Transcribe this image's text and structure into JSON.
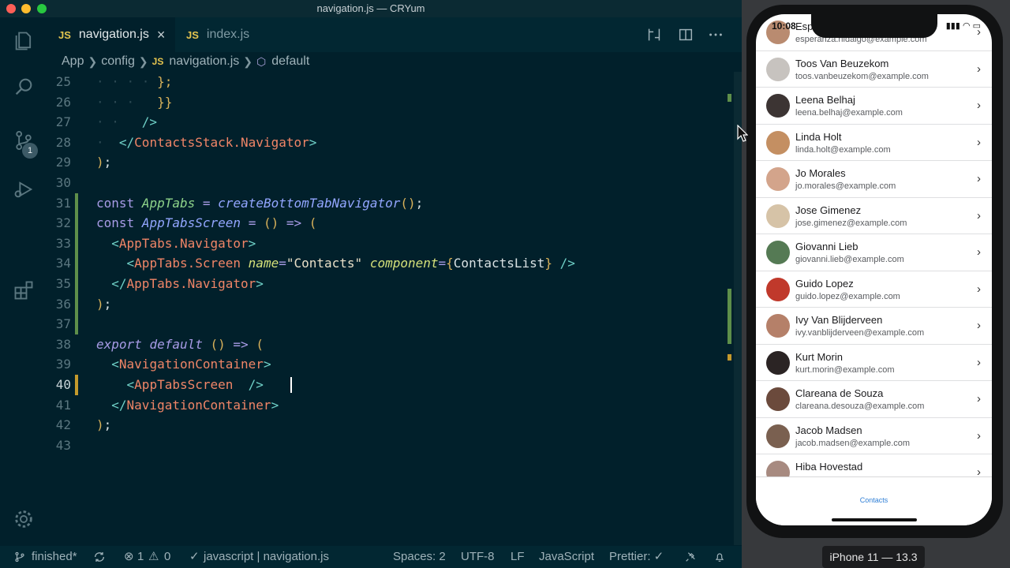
{
  "window": {
    "title": "navigation.js — CRYum"
  },
  "tabs": [
    {
      "label": "navigation.js",
      "badge": "JS",
      "active": true
    },
    {
      "label": "index.js",
      "badge": "JS",
      "active": false
    }
  ],
  "activity": {
    "scm_badge": "1"
  },
  "breadcrumb": {
    "items": [
      "App",
      "config",
      "navigation.js",
      "default"
    ],
    "file_badge": "JS"
  },
  "editor": {
    "line_numbers": [
      "25",
      "26",
      "27",
      "28",
      "29",
      "30",
      "31",
      "32",
      "33",
      "34",
      "35",
      "36",
      "37",
      "38",
      "39",
      "40",
      "41",
      "42",
      "43"
    ],
    "current_line": "40"
  },
  "statusbar": {
    "branch": "finished*",
    "errors": "1",
    "warnings": "0",
    "lang_check": "javascript | navigation.js",
    "spaces": "Spaces: 2",
    "encoding": "UTF-8",
    "eol": "LF",
    "language": "JavaScript",
    "prettier": "Prettier: ✓"
  },
  "simulator": {
    "time": "10:08",
    "contacts": [
      {
        "name": "Esperanza Hidalgo",
        "email": "esperanza.hidalgo@example.com",
        "color": "#b98b70"
      },
      {
        "name": "Toos Van Beuzekom",
        "email": "toos.vanbeuzekom@example.com",
        "color": "#c7c3bf"
      },
      {
        "name": "Leena Belhaj",
        "email": "leena.belhaj@example.com",
        "color": "#3c3433"
      },
      {
        "name": "Linda Holt",
        "email": "linda.holt@example.com",
        "color": "#c48f62"
      },
      {
        "name": "Jo Morales",
        "email": "jo.morales@example.com",
        "color": "#d3a48b"
      },
      {
        "name": "Jose Gimenez",
        "email": "jose.gimenez@example.com",
        "color": "#d6c3a7"
      },
      {
        "name": "Giovanni Lieb",
        "email": "giovanni.lieb@example.com",
        "color": "#557a54"
      },
      {
        "name": "Guido Lopez",
        "email": "guido.lopez@example.com",
        "color": "#c0392b"
      },
      {
        "name": "Ivy Van Blijderveen",
        "email": "ivy.vanblijderveen@example.com",
        "color": "#b58069"
      },
      {
        "name": "Kurt Morin",
        "email": "kurt.morin@example.com",
        "color": "#2b2424"
      },
      {
        "name": "Clareana de Souza",
        "email": "clareana.desouza@example.com",
        "color": "#6b4a3c"
      },
      {
        "name": "Jacob Madsen",
        "email": "jacob.madsen@example.com",
        "color": "#7a6050"
      },
      {
        "name": "Hiba Hovestad",
        "email": "",
        "color": "#a78a80"
      }
    ],
    "tab_label": "Contacts",
    "device": "iPhone 11 — 13.3"
  }
}
